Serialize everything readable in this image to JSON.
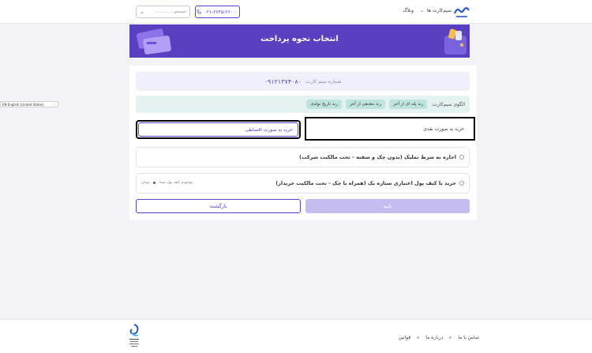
{
  "header": {
    "nav_simcards": "سیم‌کارت ها",
    "nav_blog": "وبلاگ",
    "phone": "۰۲۱-۲۷۴۵-۲۶۰۰۰",
    "search_text": "...............جستجو"
  },
  "banner": {
    "title": "انتخاب نحوه پرداخت"
  },
  "sim": {
    "label": "شماره سیم کارت:",
    "number": "۰۹۱۲۱۳۷۴۰۸۰"
  },
  "pattern": {
    "label": "الگوی سیم‌کارت:",
    "chips": [
      "رند پله ای از آخر",
      "رند دهدهی از آخر",
      "رند تاریخ تولدی"
    ]
  },
  "payment_tabs": {
    "cash": "خرید به صورت نقدی",
    "installment": "خرید به صورت اقساطی"
  },
  "options": {
    "lease": "اجاره به شرط تملیک (بدون چک و سفته - تحت مالکیت شرکت)",
    "wallet_credit": "خرید با کیف پول اعتباری ستاره یک (همراه با چک - تحت مالکیت خریدار)",
    "wallet_balance_label": "موجودی کیف پول شما:",
    "wallet_currency": "تومان"
  },
  "actions": {
    "confirm": "تایید",
    "back": "بازگشت"
  },
  "language_badge": "EN English (United States)",
  "footer": {
    "links": [
      "تماس با ما",
      "درباره ما",
      "قوانین"
    ]
  },
  "colors": {
    "brand_purple": "#5a3fc0",
    "accent": "#5b3fd6",
    "confirm_disabled": "#c5bdf0",
    "pattern_bg": "#e5f3f0",
    "chip_bg": "#bfe5dd"
  }
}
